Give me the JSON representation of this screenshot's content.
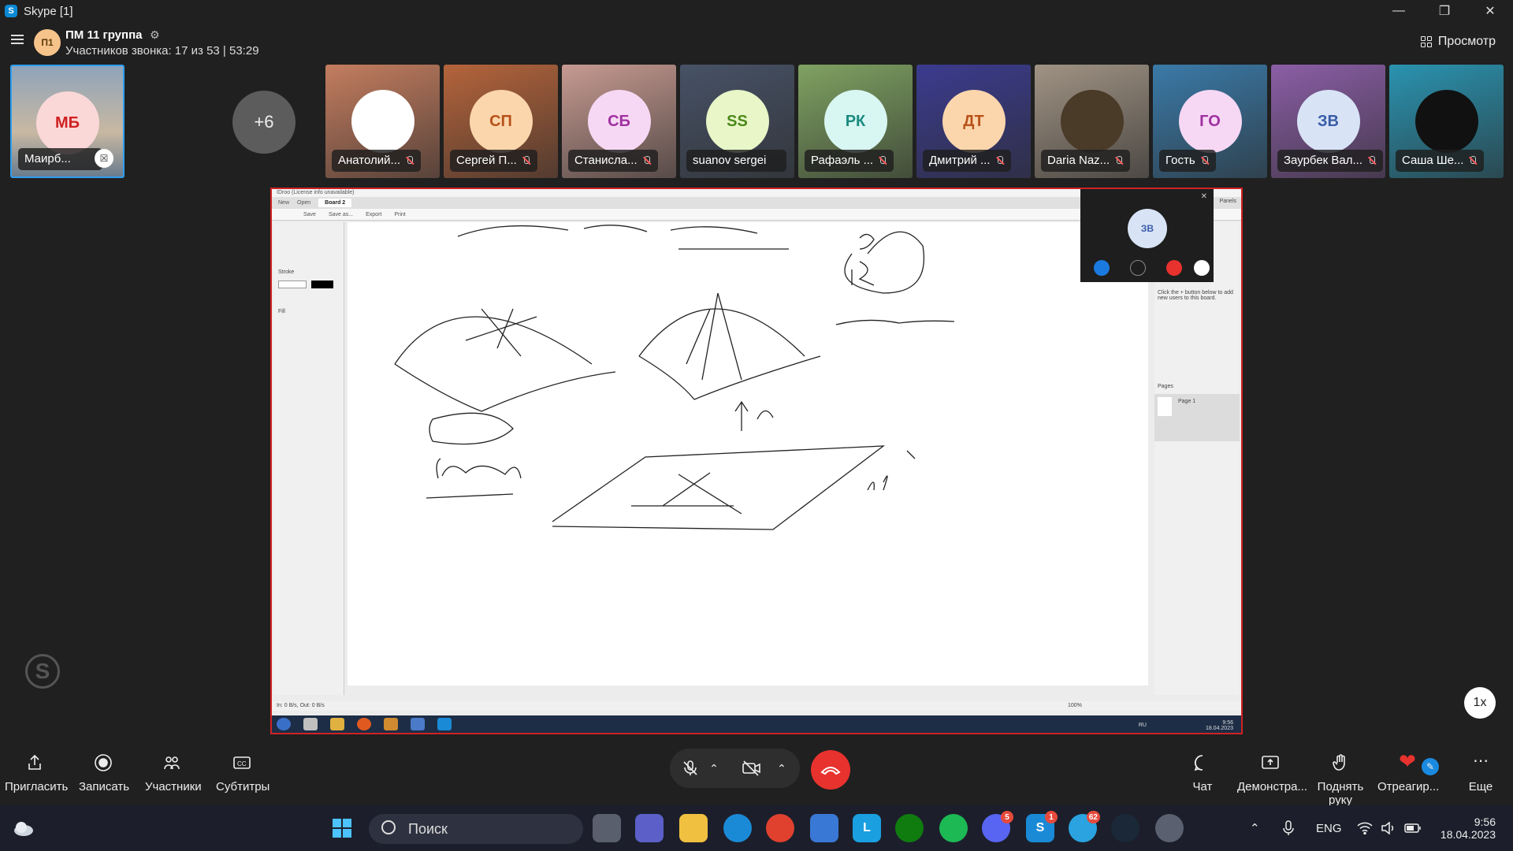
{
  "window": {
    "title": "Skype [1]",
    "app_icon": "S"
  },
  "call": {
    "group_avatar": "П1",
    "group_name": "ПМ 11 группа",
    "status": "Участников звонка: 17 из 53 | 53:29",
    "view_label": "Просмотр"
  },
  "self_tile": {
    "initials": "МБ",
    "name": "Маирб..."
  },
  "more_participants": "+6",
  "participants": [
    {
      "initials": "",
      "name": "Анатолий...",
      "bg": "#c47d5f",
      "avatar_bg": "#ffffff",
      "avatar_color": "#222",
      "photo": true
    },
    {
      "initials": "СП",
      "name": "Сергей П...",
      "bg": "#b5643b",
      "avatar_bg": "#fbd6ac",
      "avatar_color": "#b8521a"
    },
    {
      "initials": "СБ",
      "name": "Станисла...",
      "bg": "#c69a91",
      "avatar_bg": "#f6d8f4",
      "avatar_color": "#a030a0"
    },
    {
      "initials": "SS",
      "name": "suanov sergei",
      "bg": "#475266",
      "avatar_bg": "#e8f6c8",
      "avatar_color": "#4d8a1a"
    },
    {
      "initials": "РК",
      "name": "Рафаэль ...",
      "bg": "#7fa262",
      "avatar_bg": "#d8f6f2",
      "avatar_color": "#1a8a80"
    },
    {
      "initials": "ДТ",
      "name": "Дмитрий ...",
      "bg": "#3b3b8f",
      "avatar_bg": "#fbd6ac",
      "avatar_color": "#b8521a"
    },
    {
      "initials": "",
      "name": "Daria Naz...",
      "bg": "#a09384",
      "avatar_bg": "#4a3a28",
      "avatar_color": "#fff",
      "photo": true
    },
    {
      "initials": "ГО",
      "name": "Гость",
      "bg": "#3a7aa8",
      "avatar_bg": "#f6d8f4",
      "avatar_color": "#a030a0"
    },
    {
      "initials": "ЗВ",
      "name": "Заурбек Вал...",
      "bg": "#8b5ea6",
      "avatar_bg": "#d8e4f6",
      "avatar_color": "#3a5ca8"
    },
    {
      "initials": "",
      "name": "Саша Ше...",
      "bg": "#2a93b0",
      "avatar_bg": "#111111",
      "avatar_color": "#fff"
    }
  ],
  "shared_screen": {
    "app_title": "IDroo (License info unavailable)",
    "tabs": [
      "New",
      "Open",
      "Board 2"
    ],
    "toolbar": [
      "Save",
      "Save as...",
      "Export",
      "Print"
    ],
    "left_panel": {
      "stroke_label": "Stroke",
      "fill_label": "Fill"
    },
    "right_panel": {
      "hint": "Click the + button below to add new users to this board.",
      "pages_label": "Pages",
      "page_name": "Page 1",
      "panels_label": "Panels"
    },
    "status_left": "In: 0 B/s, Out: 0 B/s",
    "zoom": "100%",
    "clock_time": "9:56",
    "clock_date": "18.04.2023",
    "lang": "RU"
  },
  "mini_preview": {
    "initials": "ЗВ"
  },
  "speed_label": "1x",
  "bottom_bar": {
    "invite": "Пригласить",
    "record": "Записать",
    "participants": "Участники",
    "subtitles": "Субтитры",
    "chat": "Чат",
    "share": "Демонстра...",
    "raise_hand": "Поднять руку",
    "react": "Отреагир...",
    "more": "Еще"
  },
  "taskbar": {
    "search_label": "Поиск",
    "lang": "ENG",
    "time": "9:56",
    "date": "18.04.2023",
    "badges": {
      "discord": "5",
      "skype": "1",
      "telegram": "62"
    }
  }
}
